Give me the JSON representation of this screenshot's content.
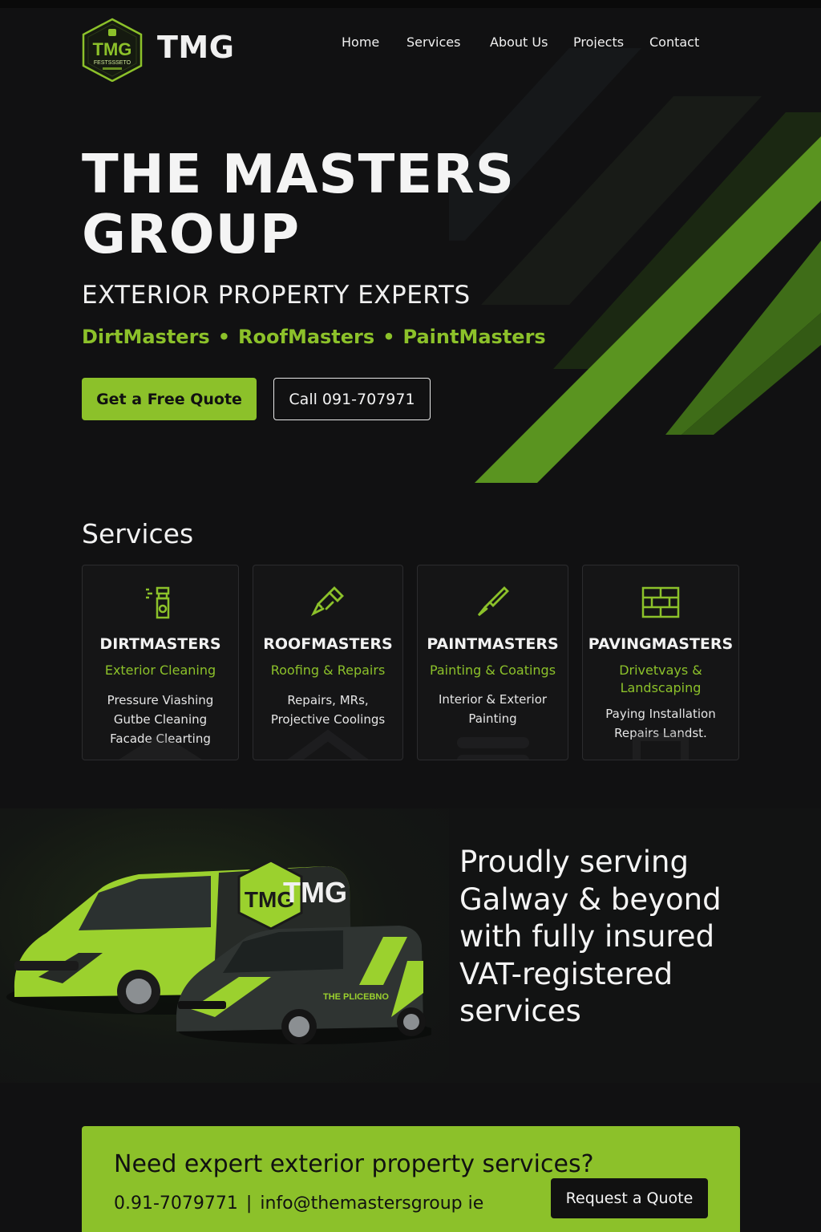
{
  "header": {
    "logo_text": "TMG",
    "logo_subtext": "FESTSSSETO",
    "brand": "TMG",
    "nav": [
      {
        "label": "Home"
      },
      {
        "label": "Services"
      },
      {
        "label": "About Us"
      },
      {
        "label": "Projects"
      },
      {
        "label": "Contact"
      }
    ]
  },
  "hero": {
    "title_line1": "THE MASTERS",
    "title_line2": "GROUP",
    "subtitle": "EXTERIOR PROPERTY EXPERTS",
    "brands": [
      "DirtMasters",
      "RoofMasters",
      "PaintMasters"
    ],
    "brand_separator": "•",
    "primary_cta": "Get a Free Quote",
    "secondary_cta": "Call 091-707971"
  },
  "services": {
    "title": "Services",
    "cards": [
      {
        "icon": "spray-bottle-icon",
        "name": "DIRTMASTERS",
        "subtitle": [
          "Exterior Cleaning"
        ],
        "lines": [
          "Pressure Viashing",
          "Gutbe Cleaning",
          "Facade Clearting"
        ]
      },
      {
        "icon": "roof-tool-icon",
        "name": "ROOFMASTERS",
        "subtitle": [
          "Roofing & Repairs"
        ],
        "lines": [
          "Repairs, MRs,",
          "Projective Coolings"
        ]
      },
      {
        "icon": "paint-brush-icon",
        "name": "PAINTMASTERS",
        "subtitle": [
          "Painting & Coatings"
        ],
        "lines": [
          "Interior & Exterior",
          "Painting"
        ]
      },
      {
        "icon": "brick-wall-icon",
        "name": "PAVINGMASTERS",
        "subtitle": [
          "Drivetvays &",
          "Landscaping"
        ],
        "lines": [
          "Paying Installation",
          "Repairs Landst."
        ]
      }
    ]
  },
  "fleet": {
    "van_text_large": "TMG",
    "van_text_small": "THE PLICEBNO",
    "message_lines": [
      "Proudly serving",
      "Galway & beyond",
      "with fully insured",
      "VAT-registered",
      "services"
    ]
  },
  "cta": {
    "title": "Need expert exterior property services?",
    "phone": "0.91-7079771",
    "separator": "|",
    "email": "info@themastersgroup ie",
    "button": "Request a Quote"
  },
  "colors": {
    "accent": "#8cc12a",
    "background": "#111112",
    "text": "#f2f2f2"
  }
}
